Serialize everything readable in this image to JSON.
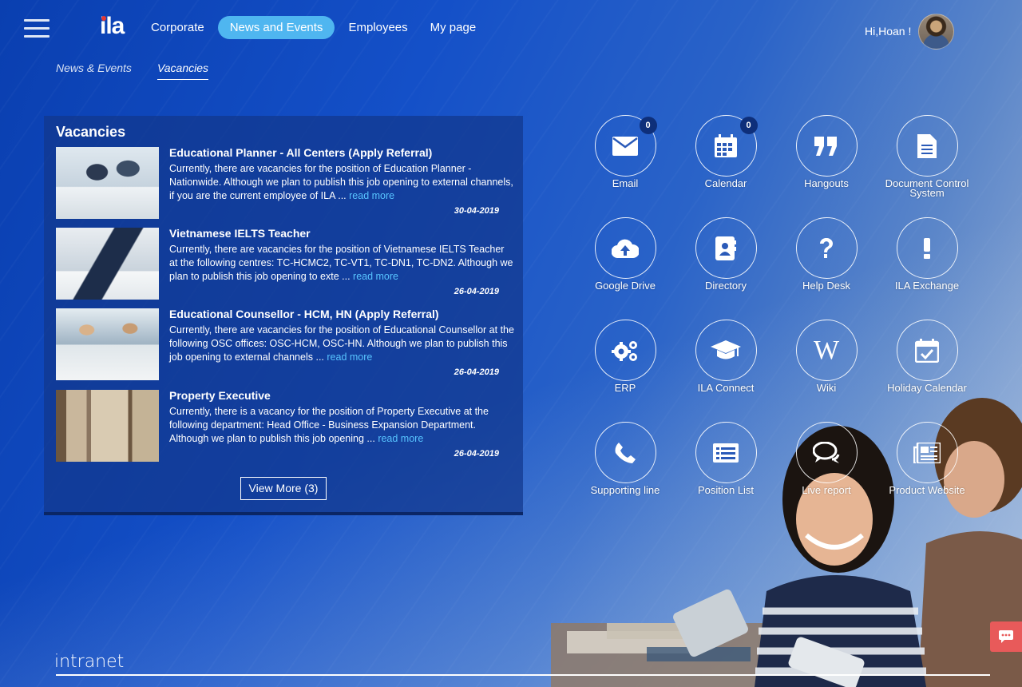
{
  "header": {
    "logo": "ila",
    "nav": [
      "Corporate",
      "News and Events",
      "Employees",
      "My page"
    ],
    "active_nav": "News and Events",
    "greeting": "Hi,Hoan !"
  },
  "subtabs": [
    "News & Events",
    "Vacancies"
  ],
  "vacancies": {
    "heading": "Vacancies",
    "items": [
      {
        "title": "Educational Planner - All Centers (Apply Referral)",
        "desc": "Currently, there are vacancies for the position of Education Planner - Nationwide. Although we plan to publish this job opening to external channels, if you are the current employee of ILA ...",
        "more": "read more",
        "date": "30-04-2019"
      },
      {
        "title": "Vietnamese IELTS Teacher",
        "desc": "Currently, there are vacancies for the position of Vietnamese IELTS Teacher at the following centres: TC-HCMC2, TC-VT1, TC-DN1, TC-DN2. Although we plan to publish this job opening to exte ...",
        "more": "read more",
        "date": "26-04-2019"
      },
      {
        "title": "Educational Counsellor - HCM, HN (Apply Referral)",
        "desc": "Currently, there are vacancies for the position of Educational Counsellor at the following OSC offices: OSC-HCM, OSC-HN. Although we plan to publish this job opening to external channels ...",
        "more": "read more",
        "date": "26-04-2019"
      },
      {
        "title": "Property Executive",
        "desc": "Currently, there is a vacancy for the position of Property Executive at the following department: Head Office - Business Expansion Department. Although we plan to publish this job opening ...",
        "more": "read more",
        "date": "26-04-2019"
      }
    ],
    "view_more": "View More (3)"
  },
  "apps": [
    {
      "label": "Email",
      "icon": "envelope-icon",
      "badge": "0"
    },
    {
      "label": "Calendar",
      "icon": "calendar-icon",
      "badge": "0"
    },
    {
      "label": "Hangouts",
      "icon": "quote-icon"
    },
    {
      "label": "Document Control System",
      "icon": "document-icon"
    },
    {
      "label": "Google Drive",
      "icon": "cloud-upload-icon"
    },
    {
      "label": "Directory",
      "icon": "contact-book-icon"
    },
    {
      "label": "Help Desk",
      "icon": "question-icon"
    },
    {
      "label": "ILA Exchange",
      "icon": "exclamation-icon"
    },
    {
      "label": "ERP",
      "icon": "gears-icon"
    },
    {
      "label": "ILA Connect",
      "icon": "graduation-cap-icon"
    },
    {
      "label": "Wiki",
      "icon": "wikipedia-icon"
    },
    {
      "label": "Holiday Calendar",
      "icon": "calendar-check-icon"
    },
    {
      "label": "Supporting line",
      "icon": "phone-icon"
    },
    {
      "label": "Position List",
      "icon": "list-icon"
    },
    {
      "label": "Live report",
      "icon": "chat-bubbles-icon"
    },
    {
      "label": "Product Website",
      "icon": "newspaper-icon"
    }
  ],
  "footer": {
    "brand": "intranet"
  },
  "colors": {
    "accent": "#4fb6f0",
    "link": "#58c4ff",
    "chat": "#e85a5a"
  }
}
